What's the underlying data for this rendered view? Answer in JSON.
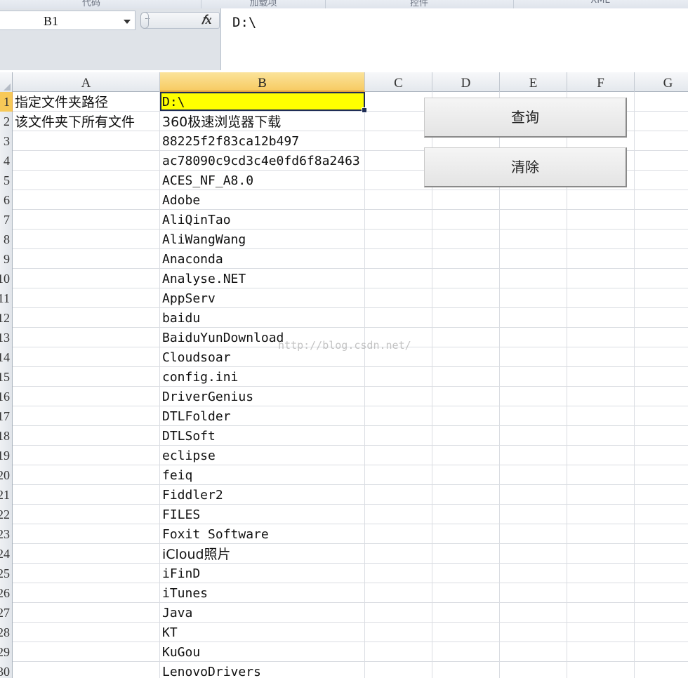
{
  "ribbon": {
    "groups": [
      "代码",
      "加载项",
      "控件",
      "XML"
    ]
  },
  "formula_bar": {
    "name_box": "B1",
    "fx_label": "fx",
    "value": "D:\\"
  },
  "columns": [
    "A",
    "B",
    "C",
    "D",
    "E",
    "F",
    "G"
  ],
  "rows": [
    {
      "num": "1",
      "a": "指定文件夹路径",
      "b": "D:\\"
    },
    {
      "num": "2",
      "a": "该文件夹下所有文件",
      "b": "360极速浏览器下载"
    },
    {
      "num": "3",
      "a": "",
      "b": "88225f2f83ca12b497"
    },
    {
      "num": "4",
      "a": "",
      "b": "ac78090c9cd3c4e0fd6f8a2463"
    },
    {
      "num": "5",
      "a": "",
      "b": "ACES_NF_A8.0"
    },
    {
      "num": "6",
      "a": "",
      "b": "Adobe"
    },
    {
      "num": "7",
      "a": "",
      "b": "AliQinTao"
    },
    {
      "num": "8",
      "a": "",
      "b": "AliWangWang"
    },
    {
      "num": "9",
      "a": "",
      "b": "Anaconda"
    },
    {
      "num": "10",
      "a": "",
      "b": "Analyse.NET"
    },
    {
      "num": "11",
      "a": "",
      "b": "AppServ"
    },
    {
      "num": "12",
      "a": "",
      "b": "baidu"
    },
    {
      "num": "13",
      "a": "",
      "b": "BaiduYunDownload"
    },
    {
      "num": "14",
      "a": "",
      "b": "Cloudsoar"
    },
    {
      "num": "15",
      "a": "",
      "b": "config.ini"
    },
    {
      "num": "16",
      "a": "",
      "b": "DriverGenius"
    },
    {
      "num": "17",
      "a": "",
      "b": "DTLFolder"
    },
    {
      "num": "18",
      "a": "",
      "b": "DTLSoft"
    },
    {
      "num": "19",
      "a": "",
      "b": "eclipse"
    },
    {
      "num": "20",
      "a": "",
      "b": "feiq"
    },
    {
      "num": "21",
      "a": "",
      "b": "Fiddler2"
    },
    {
      "num": "22",
      "a": "",
      "b": "FILES"
    },
    {
      "num": "23",
      "a": "",
      "b": "Foxit Software"
    },
    {
      "num": "24",
      "a": "",
      "b": "iCloud照片"
    },
    {
      "num": "25",
      "a": "",
      "b": "iFinD"
    },
    {
      "num": "26",
      "a": "",
      "b": "iTunes"
    },
    {
      "num": "27",
      "a": "",
      "b": "Java"
    },
    {
      "num": "28",
      "a": "",
      "b": "KT"
    },
    {
      "num": "29",
      "a": "",
      "b": "KuGou"
    },
    {
      "num": "30",
      "a": "",
      "b": "LenovoDrivers"
    }
  ],
  "buttons": {
    "query": "查询",
    "clear": "清除"
  },
  "watermark": "http://blog.csdn.net/"
}
